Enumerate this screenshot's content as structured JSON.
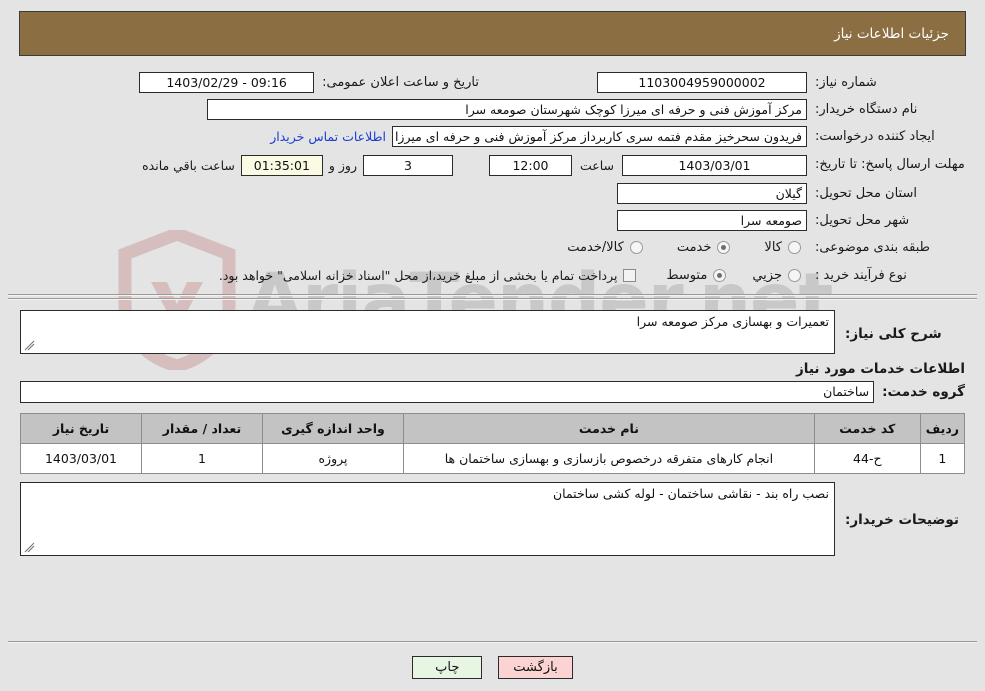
{
  "header": {
    "title": "جزئیات اطلاعات نیاز"
  },
  "fields": {
    "need_number_label": "شماره نیاز:",
    "need_number_value": "1103004959000002",
    "public_announce_label": "تاریخ و ساعت اعلان عمومی:",
    "public_announce_value": "1403/02/29 - 09:16",
    "buyer_org_label": "نام دستگاه خریدار:",
    "buyer_org_value": "مرکز آموزش فنی و حرفه ای میرزا کوچک شهرستان صومعه سرا",
    "creator_label": "ایجاد کننده درخواست:",
    "creator_value": "فریدون  سحرخیز مقدم فتمه سری کاربرداز مرکز آموزش فنی و حرفه ای میرزا کو",
    "contact_link": "اطلاعات تماس خریدار",
    "deadline_label": "مهلت ارسال پاسخ: تا تاریخ:",
    "deadline_date": "1403/03/01",
    "hour_label": "ساعت",
    "hour_value": "12:00",
    "days_value": "3",
    "days_label": "روز و",
    "countdown_value": "01:35:01",
    "countdown_label": "ساعت باقي مانده",
    "province_label": "استان محل تحویل:",
    "province_value": "گیلان",
    "city_label": "شهر محل تحویل:",
    "city_value": "صومعه سرا",
    "category_label": "طبقه بندی موضوعی:",
    "process_label": "نوع فرآیند خرید :",
    "treasury_note": "پرداخت تمام یا بخشی از مبلغ خرید،از محل \"اسناد خزانه اسلامی\" خواهد بود."
  },
  "category_options": [
    {
      "label": "کالا",
      "selected": false
    },
    {
      "label": "خدمت",
      "selected": true
    },
    {
      "label": "کالا/خدمت",
      "selected": false
    }
  ],
  "process_options": [
    {
      "label": "جزیي",
      "selected": false
    },
    {
      "label": "متوسط",
      "selected": true
    }
  ],
  "treasury_checkbox_checked": false,
  "description": {
    "label": "شرح کلی نیاز:",
    "value": "تعمیرات و بهسازی مرکز صومعه سرا"
  },
  "services_section": {
    "heading": "اطلاعات خدمات مورد نیاز",
    "group_label": "گروه خدمت:",
    "group_value": "ساختمان"
  },
  "table": {
    "columns": [
      "ردیف",
      "کد خدمت",
      "نام خدمت",
      "واحد اندازه گیری",
      "تعداد / مقدار",
      "تاریخ نیاز"
    ],
    "rows": [
      {
        "row": "1",
        "code": "ح-44",
        "name": "انجام کارهای متفرقه درخصوص بازسازی و بهسازی ساختمان ها",
        "unit": "پروژه",
        "qty": "1",
        "date": "1403/03/01"
      }
    ]
  },
  "buyer_notes": {
    "label": "توضیحات خریدار:",
    "value": "نصب راه بند - نقاشی ساختمان - لوله کشی ساختمان"
  },
  "buttons": {
    "print": "چاپ",
    "back": "بازگشت"
  },
  "watermark": {
    "text": "AriaTender.net"
  },
  "colors": {
    "header_brown": "#8c6e43",
    "link_blue": "#1a3ed4",
    "print_green": "#e7f6e2",
    "back_pink": "#fbd3d3",
    "countdown_yellow": "#fbfbe3",
    "table_header_gray": "#c3c3c3"
  }
}
